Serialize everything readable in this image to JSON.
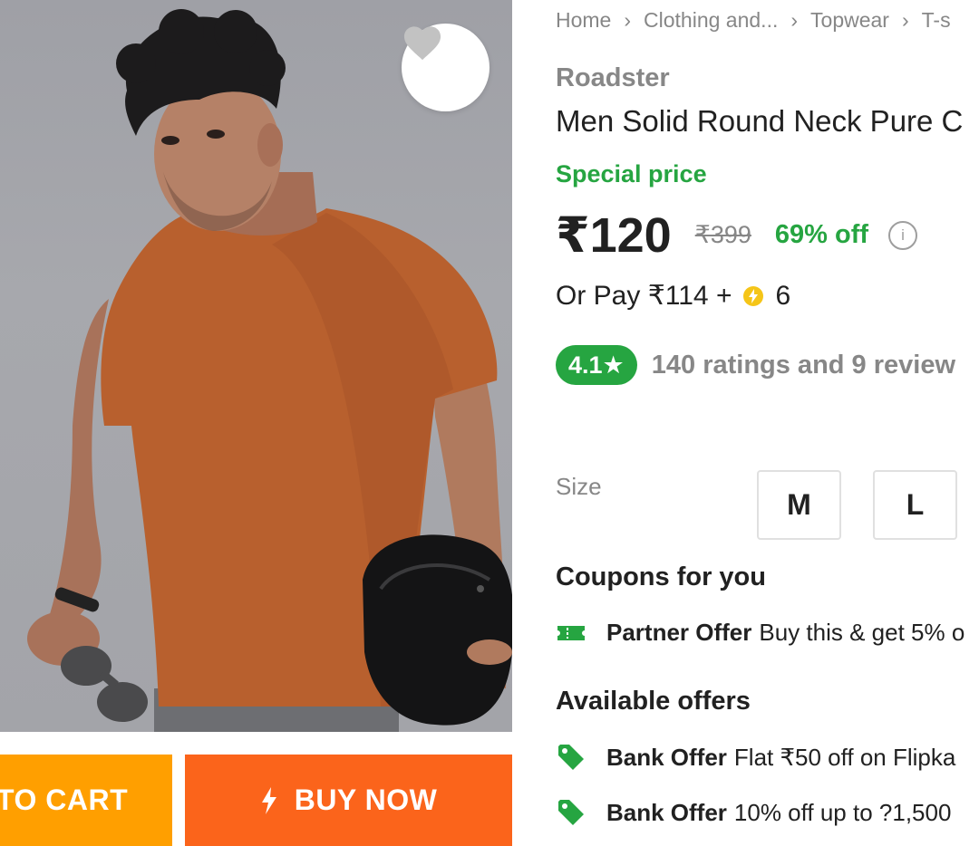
{
  "image": {
    "description_icon": "product-photo",
    "wishlist_icon": "heart-icon"
  },
  "actions": {
    "add_to_cart_label": "TO CART",
    "buy_now_label": "BUY NOW",
    "buy_icon": "lightning-icon"
  },
  "breadcrumb": {
    "items": [
      "Home",
      "Clothing and...",
      "Topwear",
      "T-s"
    ],
    "separator": "›"
  },
  "product": {
    "brand": "Roadster",
    "title": "Men Solid Round Neck Pure C",
    "special_price_label": "Special price",
    "price": "₹120",
    "mrp": "₹399",
    "discount": "69% off",
    "pay_prefix": "Or Pay ₹114 +",
    "pay_coins": "6",
    "rating": "4.1★",
    "rating_summary": "140 ratings and 9 review"
  },
  "size": {
    "label": "Size",
    "options": [
      "M",
      "L"
    ]
  },
  "coupons": {
    "title": "Coupons for you",
    "items": [
      {
        "bold": "Partner Offer",
        "text": "Buy this & get 5% o",
        "icon": "ticket-icon"
      }
    ]
  },
  "offers": {
    "title": "Available offers",
    "items": [
      {
        "bold": "Bank Offer",
        "text": "Flat ₹50 off on Flipka",
        "icon": "tag-icon"
      },
      {
        "bold": "Bank Offer",
        "text": "10% off up to ?1,500",
        "icon": "tag-icon"
      }
    ]
  },
  "colors": {
    "green": "#26a541",
    "orange_cart": "#ff9f00",
    "orange_buy": "#fb641b",
    "grey_text": "#878787",
    "shirt": "#b8602e"
  }
}
